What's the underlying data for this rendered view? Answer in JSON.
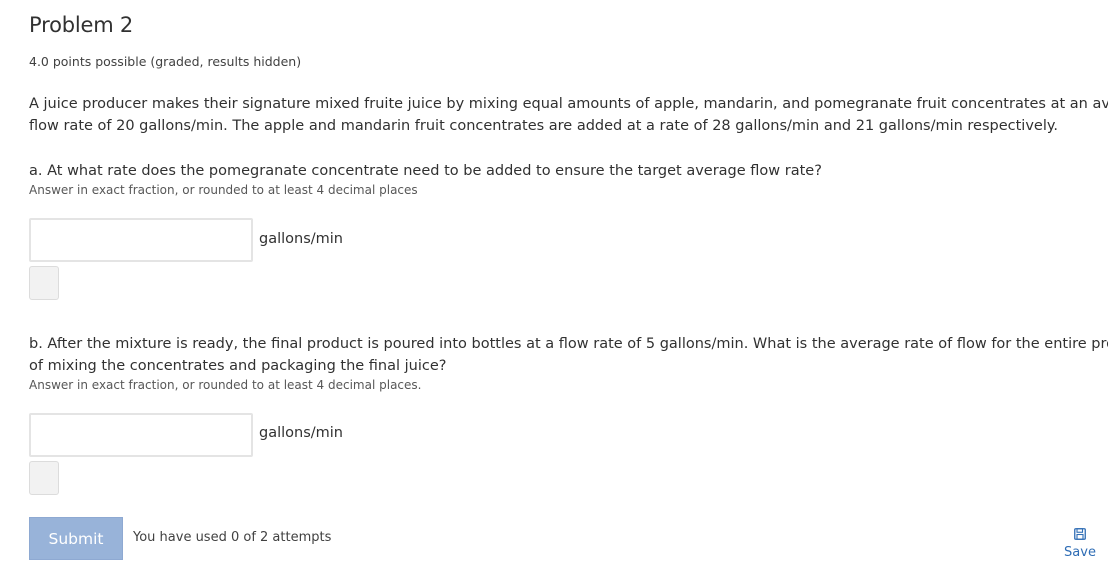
{
  "problem": {
    "title": "Problem 2",
    "points": "4.0 points possible (graded, results hidden)",
    "intro_line1": "A juice producer makes their signature mixed fruite juice by mixing equal amounts of apple, mandarin, and pomegranate fruit concentrates at an average",
    "intro_line2": "flow rate of 20 gallons/min. The apple and mandarin fruit concentrates are added at a rate of 28 gallons/min and 21 gallons/min respectively."
  },
  "part_a": {
    "question": "a. At what rate does the pomegranate concentrate need to be added to ensure the target average flow rate?",
    "hint": "Answer in exact fraction, or rounded to at least 4 decimal places",
    "value": "",
    "unit": "gallons/min"
  },
  "part_b": {
    "question_line1": "b. After the mixture is ready, the final product is poured into bottles at a flow rate of 5 gallons/min. What is the average rate of flow for the entire process",
    "question_line2": "of mixing the concentrates and packaging the final juice?",
    "hint": "Answer in exact fraction, or rounded to at least 4 decimal places.",
    "value": "",
    "unit": "gallons/min"
  },
  "actions": {
    "submit_label": "Submit",
    "attempts_text": "You have used 0 of 2 attempts",
    "save_label": "Save",
    "save_icon": "floppy-disk-icon"
  },
  "colors": {
    "submit_bg": "#98b3d9",
    "save_link": "#2f6db5",
    "input_border": "#e4e4e4"
  }
}
